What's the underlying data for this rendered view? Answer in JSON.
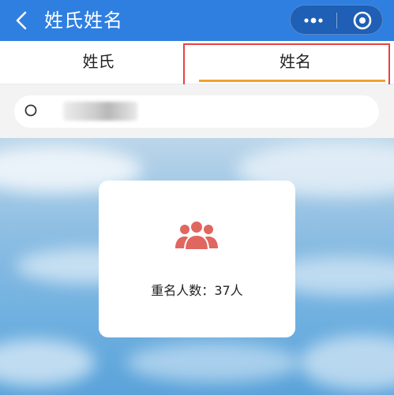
{
  "header": {
    "title": "姓氏姓名",
    "back_icon": "chevron-left-icon",
    "more_icon": "more-dots-icon",
    "target_icon": "target-circle-icon",
    "bg_color": "#2f7fe0"
  },
  "tabs": [
    {
      "label": "姓氏",
      "active": false
    },
    {
      "label": "姓名",
      "active": true
    }
  ],
  "accent_color": "#f2a12a",
  "search": {
    "value": "",
    "placeholder": "",
    "icon": "search-icon"
  },
  "result_card": {
    "icon": "people-group-icon",
    "icon_color": "#e0675f",
    "label": "重名人数：",
    "count": "37",
    "unit": "人"
  }
}
